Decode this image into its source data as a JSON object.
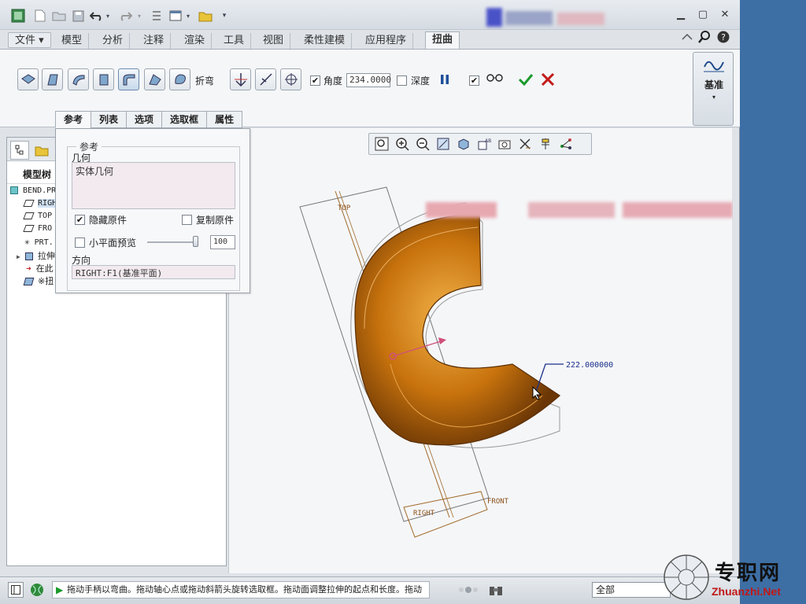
{
  "ribbon_tabs": {
    "file": "文件",
    "items": [
      "模型",
      "分析",
      "注释",
      "渲染",
      "工具",
      "视图",
      "柔性建模",
      "应用程序"
    ],
    "active": "扭曲"
  },
  "toolbar": {
    "bend_label": "折弯",
    "angle_label": "角度",
    "angle_value": "234.0000",
    "depth_label": "深度",
    "datum_label": "基准"
  },
  "dashboard_tabs": [
    "参考",
    "列表",
    "选项",
    "选取框",
    "属性"
  ],
  "ref_panel": {
    "group_title": "参考",
    "geometry_label": "几何",
    "geometry_value": "实体几何",
    "hide_original": "隐藏原件",
    "copy_original": "复制原件",
    "facet_preview": "小平面预览",
    "facet_value": "100",
    "direction_label": "方向",
    "direction_value": "RIGHT:F1(基准平面)"
  },
  "model_tree": {
    "title": "模型树",
    "items": [
      {
        "label": "BEND.PR",
        "icon": "part-icon"
      },
      {
        "label": "RIGH",
        "icon": "datum-plane-icon"
      },
      {
        "label": "TOP",
        "icon": "datum-plane-icon"
      },
      {
        "label": "FRO",
        "icon": "datum-plane-icon"
      },
      {
        "label": "PRT.",
        "icon": "csys-icon"
      },
      {
        "label": "拉伸",
        "icon": "extrude-icon"
      },
      {
        "label": "在此",
        "icon": "insert-here-icon"
      },
      {
        "label": "※扭",
        "icon": "warp-icon"
      }
    ]
  },
  "viewport": {
    "plane_top": "TOP",
    "plane_right": "RIGHT",
    "plane_front": "FRONT",
    "dimension": "222.000000"
  },
  "status": {
    "message": "拖动手柄以弯曲。拖动轴心点或拖动斜箭头旋转选取框。拖动面调整拉伸的起点和长度。拖动",
    "filter": "全部"
  },
  "watermark": {
    "text": "专职网",
    "url": "Zhuanzhi.Net"
  },
  "colors": {
    "accent_ok": "#1a9a2a",
    "accent_cancel": "#c41a1a",
    "model": "#c8730d",
    "background": "#3d6fa5"
  }
}
